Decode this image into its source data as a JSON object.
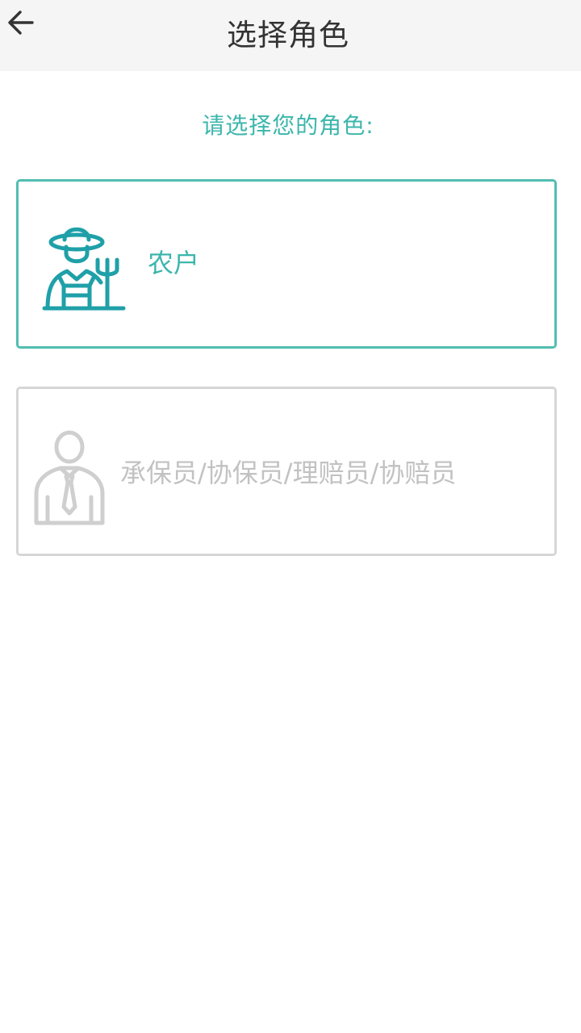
{
  "header": {
    "title": "选择角色",
    "back_icon": "arrow-left-icon"
  },
  "prompt": "请选择您的角色:",
  "roles": [
    {
      "label": "农户",
      "icon": "farmer-icon",
      "selected": true,
      "color": "#3cb6ac"
    },
    {
      "label": "承保员/协保员/理赔员/协赔员",
      "icon": "staff-icon",
      "selected": false,
      "color": "#c2c2c2"
    }
  ]
}
